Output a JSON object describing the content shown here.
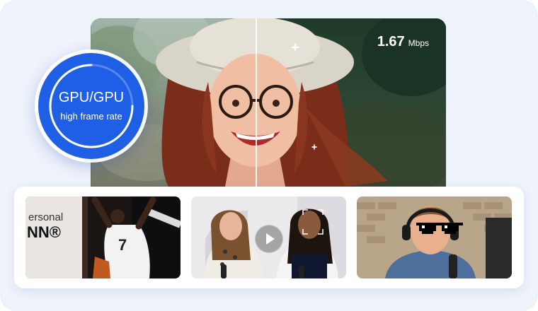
{
  "badge": {
    "title": "GPU/GPU",
    "subtitle": "high frame rate"
  },
  "bitrate": {
    "value": "1.67",
    "unit": "Mbps"
  },
  "thumbnails": [
    {
      "name": "basketball",
      "sign_text": "ersonal",
      "sign_logo": "NN®",
      "jersey_number": "7"
    },
    {
      "name": "interview",
      "play_icon": "play-icon"
    },
    {
      "name": "podcast",
      "overlay_icon": "pixel-sunglasses-icon"
    }
  ],
  "colors": {
    "badge": "#1f5fe6",
    "card_background": "#eef2fb",
    "strip_background": "#ffffff"
  }
}
